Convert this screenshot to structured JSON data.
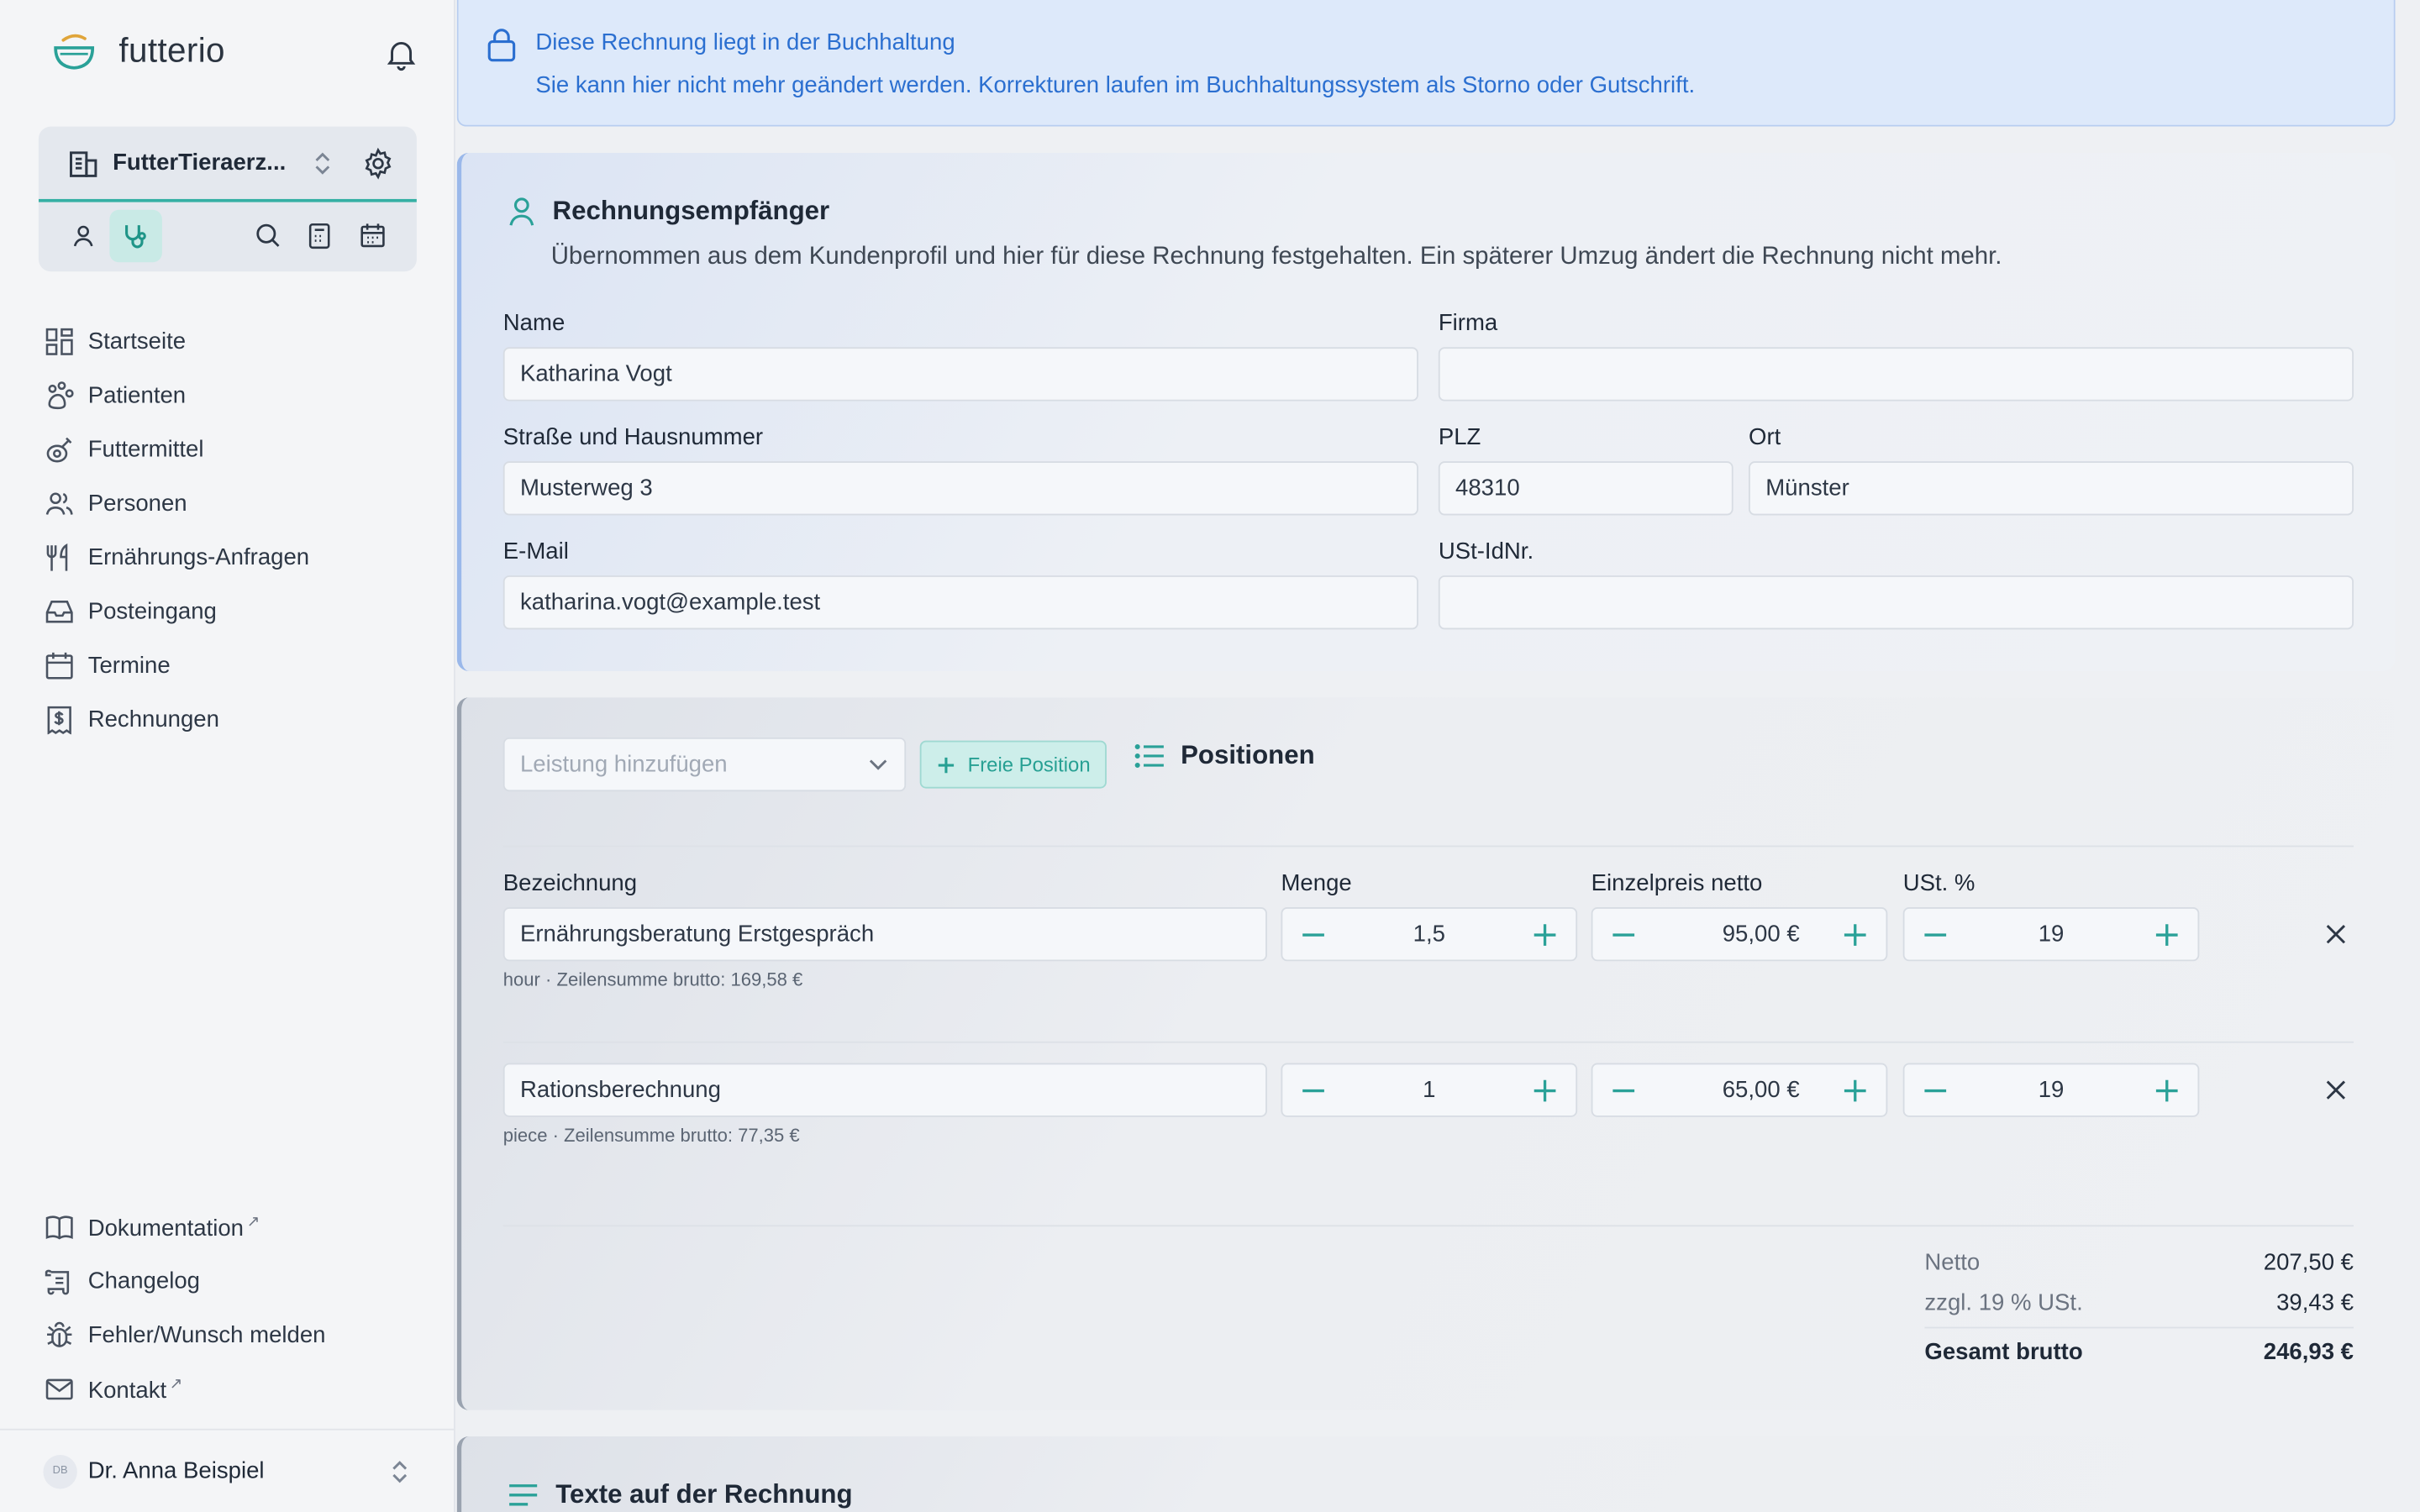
{
  "app": {
    "logo": "futterio"
  },
  "clinic": {
    "name": "FutterTieraerz..."
  },
  "nav": [
    {
      "label": "Startseite",
      "icon": "dashboard-icon"
    },
    {
      "label": "Patienten",
      "icon": "paw-icon"
    },
    {
      "label": "Futtermittel",
      "icon": "food-icon"
    },
    {
      "label": "Personen",
      "icon": "people-icon"
    },
    {
      "label": "Ernährungs-Anfragen",
      "icon": "fork-knife-icon"
    },
    {
      "label": "Posteingang",
      "icon": "inbox-icon"
    },
    {
      "label": "Termine",
      "icon": "calendar-icon"
    },
    {
      "label": "Rechnungen",
      "icon": "invoice-icon"
    }
  ],
  "nav_bottom": [
    {
      "label": "Dokumentation",
      "ext": "↗"
    },
    {
      "label": "Changelog",
      "ext": ""
    },
    {
      "label": "Fehler/Wunsch melden",
      "ext": ""
    },
    {
      "label": "Kontakt",
      "ext": "↗"
    }
  ],
  "user": {
    "initials": "DB",
    "name": "Dr. Anna Beispiel"
  },
  "banner": {
    "title": "Diese Rechnung liegt in der Buchhaltung",
    "text": "Sie kann hier nicht mehr geändert werden. Korrekturen laufen im Buchhaltungssystem als Storno oder Gutschrift."
  },
  "recipient": {
    "title": "Rechnungsempfänger",
    "subtitle": "Übernommen aus dem Kundenprofil und hier für diese Rechnung festgehalten. Ein späterer Umzug ändert die Rechnung nicht mehr.",
    "labels": {
      "name": "Name",
      "company": "Firma",
      "street": "Straße und Hausnummer",
      "zip": "PLZ",
      "city": "Ort",
      "email": "E-Mail",
      "vat": "USt-IdNr."
    },
    "values": {
      "name": "Katharina Vogt",
      "company": "",
      "street": "Musterweg 3",
      "zip": "48310",
      "city": "Münster",
      "email": "katharina.vogt@example.test",
      "vat": ""
    }
  },
  "positions": {
    "title": "Positionen",
    "add_placeholder": "Leistung hinzufügen",
    "free_button": "Freie Position",
    "headers": {
      "name": "Bezeichnung",
      "qty": "Menge",
      "price": "Einzelpreis netto",
      "vat": "USt. %"
    },
    "rows": [
      {
        "name": "Ernährungsberatung Erstgespräch",
        "qty": "1,5",
        "price": "95,00 €",
        "vat": "19",
        "hint": "hour · Zeilensumme brutto: 169,58 €"
      },
      {
        "name": "Rationsberechnung",
        "qty": "1",
        "price": "65,00 €",
        "vat": "19",
        "hint": "piece · Zeilensumme brutto: 77,35 €"
      }
    ],
    "totals": {
      "net_label": "Netto",
      "net": "207,50 €",
      "vat_label": "zzgl. 19 % USt.",
      "vat": "39,43 €",
      "gross_label": "Gesamt brutto",
      "gross": "246,93 €"
    }
  },
  "texts": {
    "title": "Texte auf der Rechnung"
  },
  "colors": {
    "accent": "#2aa198",
    "info": "#2b6fd0"
  }
}
